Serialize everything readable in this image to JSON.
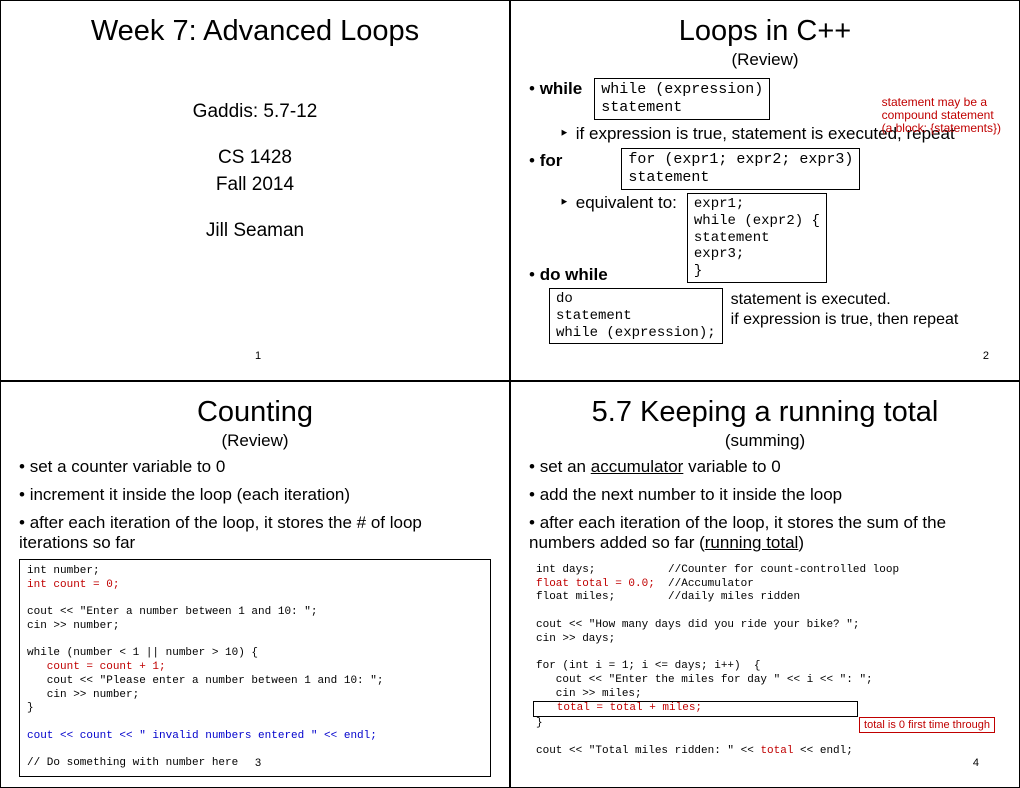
{
  "slide1": {
    "title": "Week 7: Advanced Loops",
    "line1": "Gaddis: 5.7-12",
    "line2": "CS 1428",
    "line3": "Fall 2014",
    "line4": "Jill Seaman",
    "page": "1"
  },
  "slide2": {
    "title": "Loops in C++",
    "subtitle": "(Review)",
    "rednote1a": "statement may be a",
    "rednote1b": "compound statement",
    "rednote1c": "(a block: {statements})",
    "b1": "while",
    "code1a": "while (expression)",
    "code1b": "   statement",
    "sub1": "if expression is true, statement is executed, repeat",
    "b2": "for",
    "code2a": "for (expr1; expr2; expr3)",
    "code2b": "   statement",
    "sub2": "equivalent to:",
    "code3a": "expr1;",
    "code3b": "while (expr2) {",
    "code3c": "   statement",
    "code3d": "   expr3;",
    "code3e": "}",
    "b3": "do while",
    "code4a": "do",
    "code4b": "   statement",
    "code4c": "while (expression);",
    "note4a": "statement is executed.",
    "note4b": "if expression is true, then repeat",
    "page": "2"
  },
  "slide3": {
    "title": "Counting",
    "subtitle": "(Review)",
    "b1": "set a counter variable to 0",
    "b2": "increment it inside the loop (each iteration)",
    "b3": "after each iteration of the loop, it stores the # of loop iterations so far",
    "c1": "int number;",
    "c2": "int count = 0;",
    "c3": "cout << \"Enter a number between 1 and 10: \";",
    "c4": "cin >> number;",
    "c5": "while (number < 1 || number > 10) {",
    "c6": "   count = count + 1;",
    "c7": "   cout << \"Please enter a number between 1 and 10: \";",
    "c8": "   cin >> number;",
    "c9": "}",
    "c10": "cout << count << \" invalid numbers entered \" << endl;",
    "c11": "// Do something with number here",
    "page": "3"
  },
  "slide4": {
    "title": "5.7 Keeping a running total",
    "subtitle": "(summing)",
    "b1a": "set an ",
    "b1u": "accumulator",
    "b1b": " variable to 0",
    "b2": "add the next number to it inside the loop",
    "b3a": "after each iteration of the loop, it stores the sum of the numbers added so far (",
    "b3u": "running total",
    "b3b": ")",
    "c1": "int days;           //Counter for count-controlled loop",
    "c2a": "float total = 0.0;",
    "c2b": "  //Accumulator",
    "c3": "float miles;        //daily miles ridden",
    "c4": "cout << \"How many days did you ride your bike? \";",
    "c5": "cin >> days;",
    "c6": "for (int i = 1; i <= days; i++)  {",
    "c7": "   cout << \"Enter the miles for day \" << i << \": \";",
    "c8": "   cin >> miles;",
    "c9": "   total = total + miles;",
    "c10": "}",
    "c11a": "cout << \"Total miles ridden: \" << ",
    "c11b": "total",
    "c11c": " << endl;",
    "rednote": "total is 0 first time through",
    "page": "4"
  }
}
